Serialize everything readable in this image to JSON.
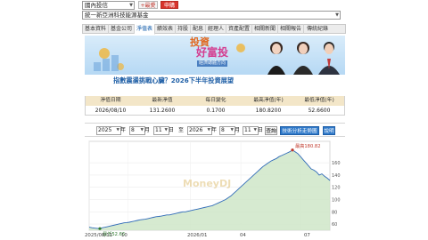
{
  "top": {
    "fund_type_select": "國內投信",
    "fund_name_select": "統一新亞洲科技能源基金",
    "btn_add": "+最愛",
    "btn_subscribe": "申購"
  },
  "tabs": [
    "基本資料",
    "基金公司",
    "淨值表",
    "績效表",
    "持股",
    "配息",
    "經理人",
    "資產配置",
    "相關新聞",
    "相關報告",
    "傳統紀錄"
  ],
  "banner": {
    "title_line1": "投資",
    "title_line2": "好富投",
    "subtitle": "經濟總體方向",
    "caption": "指數震盪挑戰心臟？2026下半年投資展望"
  },
  "table": {
    "headers": [
      "淨值日期",
      "最新淨值",
      "每日變化",
      "最高淨值(年)",
      "最低淨值(年)"
    ],
    "values": [
      "2026/08/10",
      "131.2600",
      "0.1700",
      "180.8200",
      "52.6600"
    ]
  },
  "range": {
    "from_year": "2025",
    "year_label_1": "年",
    "from_month": "8",
    "month_label_1": "月",
    "from_day": "11",
    "day_label_1": "日",
    "sep": "至",
    "to_year": "2026",
    "year_label_2": "年",
    "to_month": "8",
    "month_label_2": "月",
    "to_day": "11",
    "day_label_2": "日",
    "query_btn": "查詢",
    "tech_btn": "技術分析走勢圖",
    "legend": "說明"
  },
  "chart_data": {
    "type": "area",
    "watermark": "MoneyDJ",
    "x_ticks": [
      "2025/08/11",
      "10",
      "2026/01",
      "04",
      "07"
    ],
    "y_ticks": [
      "160",
      "140",
      "120",
      "100",
      "80",
      "60"
    ],
    "ylim": [
      50,
      195
    ],
    "high_label": "最高180.82",
    "low_label": "最低52.66",
    "series": [
      {
        "values": [
          55,
          54,
          53.5,
          53,
          52.66,
          54,
          55,
          56,
          57,
          58,
          59,
          60,
          61,
          62,
          62.5,
          63,
          64,
          65,
          66,
          67,
          67.5,
          68,
          69,
          70,
          71,
          72,
          72.5,
          73,
          74,
          75,
          75,
          76,
          77,
          78,
          79,
          80,
          80,
          81,
          82,
          83,
          84,
          85,
          86,
          87,
          88,
          89,
          90,
          92,
          94,
          96,
          98,
          100,
          103,
          106,
          110,
          114,
          118,
          122,
          126,
          130,
          134,
          138,
          142,
          146,
          150,
          154,
          157,
          160,
          163,
          165,
          167,
          170,
          172,
          174,
          176,
          178,
          180.82,
          178,
          175,
          170,
          165,
          160,
          155,
          150,
          148,
          145,
          140,
          142,
          138,
          135,
          131.26
        ]
      }
    ]
  }
}
